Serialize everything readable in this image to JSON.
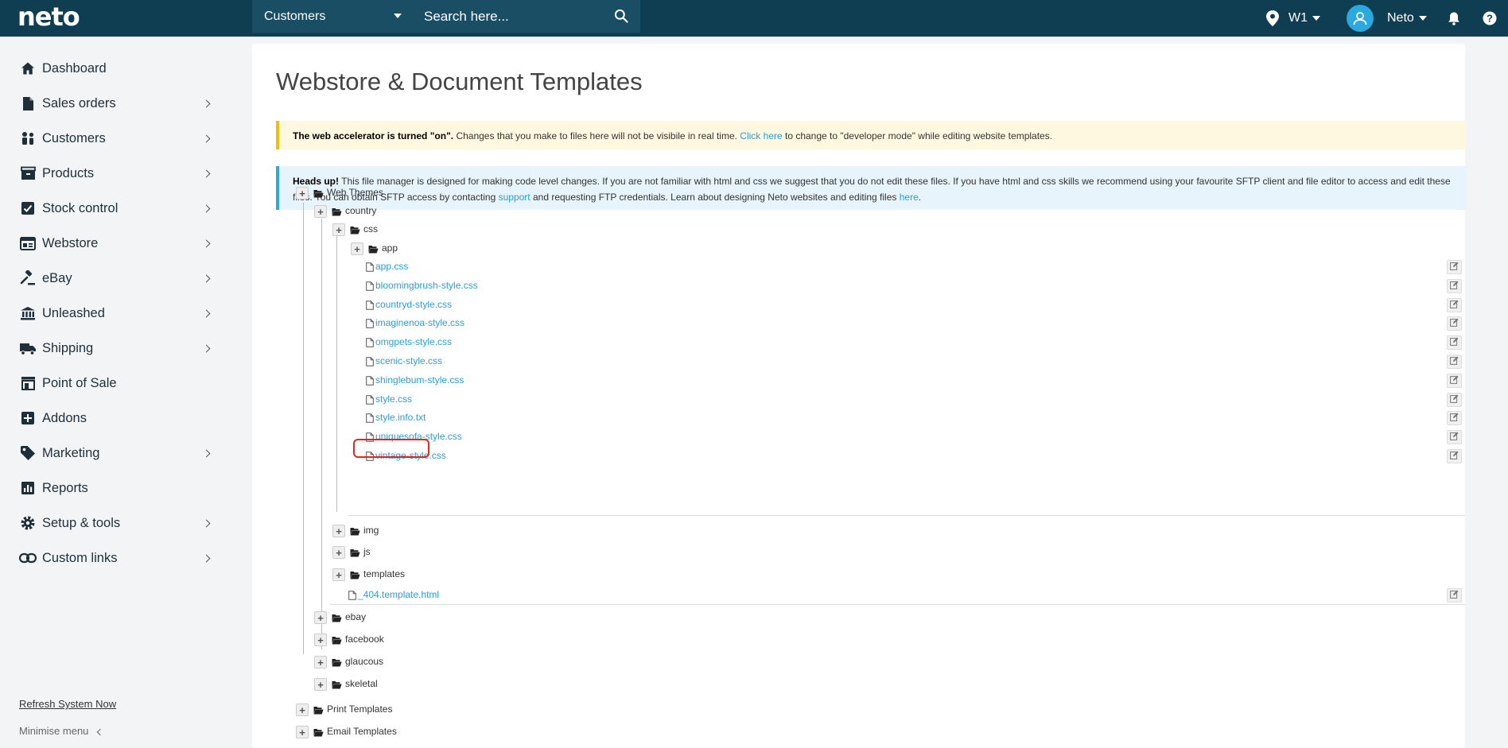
{
  "app": {
    "logo": "neto"
  },
  "search": {
    "category": "Customers",
    "placeholder": "Search here..."
  },
  "topbar": {
    "location": "W1",
    "user": "Neto"
  },
  "sidebar": {
    "items": [
      {
        "label": "Dashboard",
        "icon": "home-icon",
        "has_children": false
      },
      {
        "label": "Sales orders",
        "icon": "document-icon",
        "has_children": true
      },
      {
        "label": "Customers",
        "icon": "users-icon",
        "has_children": true
      },
      {
        "label": "Products",
        "icon": "box-icon",
        "has_children": true
      },
      {
        "label": "Stock control",
        "icon": "checkbox-icon",
        "has_children": true
      },
      {
        "label": "Webstore",
        "icon": "browser-icon",
        "has_children": true
      },
      {
        "label": "eBay",
        "icon": "gavel-icon",
        "has_children": true
      },
      {
        "label": "Unleashed",
        "icon": "bank-icon",
        "has_children": true
      },
      {
        "label": "Shipping",
        "icon": "truck-icon",
        "has_children": true
      },
      {
        "label": "Point of Sale",
        "icon": "store-icon",
        "has_children": false
      },
      {
        "label": "Addons",
        "icon": "plus-square-icon",
        "has_children": false
      },
      {
        "label": "Marketing",
        "icon": "tag-icon",
        "has_children": true
      },
      {
        "label": "Reports",
        "icon": "bar-chart-icon",
        "has_children": false
      },
      {
        "label": "Setup & tools",
        "icon": "gear-icon",
        "has_children": true
      },
      {
        "label": "Custom links",
        "icon": "link-icon",
        "has_children": true
      }
    ],
    "refresh": "Refresh System Now",
    "minimise": "Minimise menu"
  },
  "main": {
    "title": "Webstore & Document Templates",
    "warning": {
      "bold": "The web accelerator is turned \"on\".",
      "text1": " Changes that you make to files here will not be visibile in real time. ",
      "link": "Click here",
      "text2": " to change to \"developer mode\" while editing website templates."
    },
    "info": {
      "bold": "Heads up!",
      "text1": " This file manager is designed for making code level changes. If you are not familiar with html and css we suggest that you do not edit these files. If you have html and css skills we recommend using your favourite SFTP client and file editor to access and edit these files. You can obtain SFTP access by contacting ",
      "link1": "support",
      "text2": " and requesting FTP credentials. Learn about designing Neto websites and editing files ",
      "link2": "here",
      "text3": "."
    }
  },
  "tree": {
    "web_themes": "Web Themes",
    "country": "country",
    "css": "css",
    "app": "app",
    "css_files": [
      "app.css",
      "bloomingbrush-style.css",
      "countryd-style.css",
      "imaginenoa-style.css",
      "omgpets-style.css",
      "scenic-style.css",
      "shinglebum-style.css",
      "style.css",
      "style.info.txt",
      "uniquesofa-style.css",
      "vintage-style.css"
    ],
    "img": "img",
    "js": "js",
    "templates": "templates",
    "country_file": "_404.template.html",
    "ebay": "ebay",
    "facebook": "facebook",
    "glaucous": "glaucous",
    "skeletal": "skeletal",
    "print_templates": "Print Templates",
    "email_templates": "Email Templates"
  }
}
